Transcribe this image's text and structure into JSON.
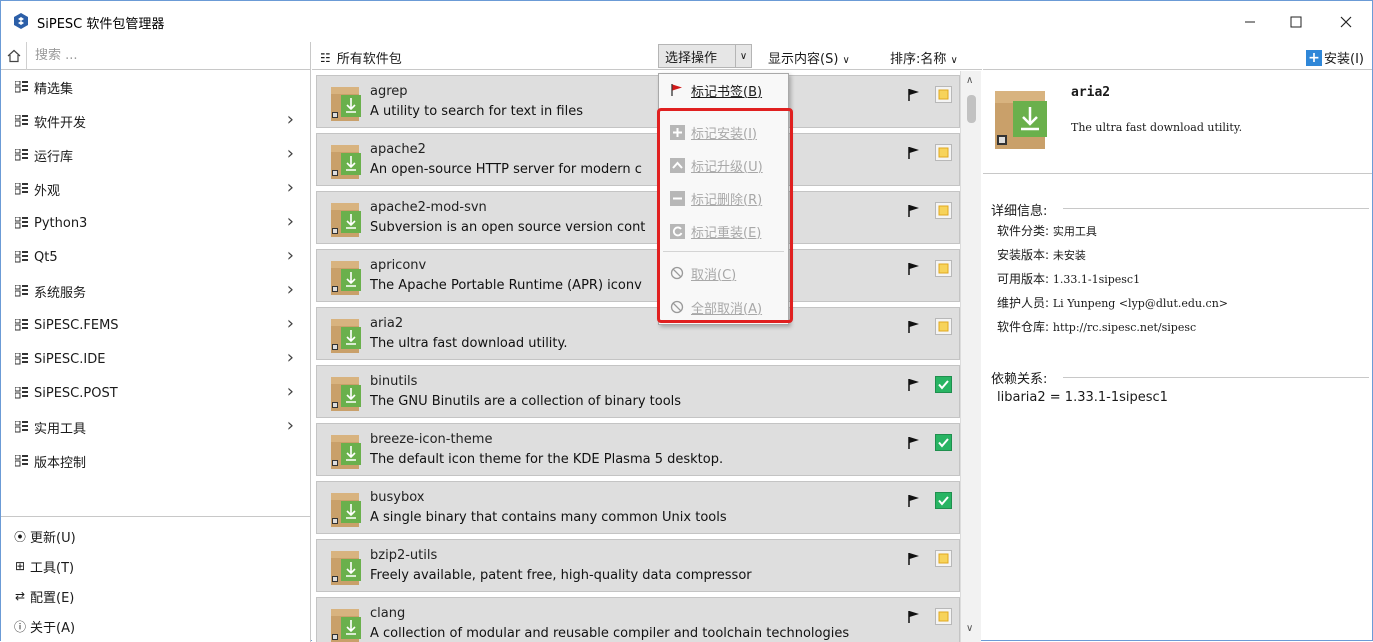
{
  "window": {
    "title": "SiPESC 软件包管理器",
    "controls": [
      "minimize",
      "maximize",
      "close"
    ]
  },
  "sidebar": {
    "search_placeholder": "搜索 ...",
    "categories": [
      {
        "label": "精选集",
        "has_arrow": false
      },
      {
        "label": "软件开发",
        "has_arrow": true
      },
      {
        "label": "运行库",
        "has_arrow": true
      },
      {
        "label": "外观",
        "has_arrow": true
      },
      {
        "label": "Python3",
        "has_arrow": true
      },
      {
        "label": "Qt5",
        "has_arrow": true
      },
      {
        "label": "系统服务",
        "has_arrow": true
      },
      {
        "label": "SiPESC.FEMS",
        "has_arrow": true
      },
      {
        "label": "SiPESC.IDE",
        "has_arrow": true
      },
      {
        "label": "SiPESC.POST",
        "has_arrow": true
      },
      {
        "label": "实用工具",
        "has_arrow": true
      },
      {
        "label": "版本控制",
        "has_arrow": false
      }
    ],
    "bottom": [
      {
        "label": "更新(U)",
        "icon": "update-icon"
      },
      {
        "label": "工具(T)",
        "icon": "toolbox-icon"
      },
      {
        "label": "配置(E)",
        "icon": "settings-icon"
      },
      {
        "label": "关于(A)",
        "icon": "info-icon"
      }
    ]
  },
  "toolbar": {
    "all_packages": "所有软件包",
    "select_action": "选择操作",
    "display_content": "显示内容(S)",
    "sort": "排序:名称",
    "install": "安装(I)"
  },
  "packages": [
    {
      "name": "agrep",
      "desc": "A utility to search for text in files",
      "installed": false
    },
    {
      "name": "apache2",
      "desc": "An open-source HTTP server for modern c",
      "installed": false
    },
    {
      "name": "apache2-mod-svn",
      "desc": "Subversion is an open source version cont",
      "installed": false
    },
    {
      "name": "apriconv",
      "desc": "The Apache Portable Runtime (APR) iconv",
      "installed": false
    },
    {
      "name": "aria2",
      "desc": "The ultra fast download utility.",
      "installed": false
    },
    {
      "name": "binutils",
      "desc": "The GNU Binutils are a collection of binary tools",
      "installed": true
    },
    {
      "name": "breeze-icon-theme",
      "desc": "The default icon theme for the KDE Plasma 5 desktop.",
      "installed": true
    },
    {
      "name": "busybox",
      "desc": "A single binary that contains many common Unix tools",
      "installed": true
    },
    {
      "name": "bzip2-utils",
      "desc": "Freely available, patent free, high-quality data compressor",
      "installed": false
    },
    {
      "name": "clang",
      "desc": "A collection of modular and reusable compiler and toolchain technologies",
      "installed": false
    }
  ],
  "menu": {
    "items": [
      {
        "label": "标记书签(B)",
        "enabled": true,
        "icon": "flag-icon"
      },
      {
        "label": "标记安装(I)",
        "enabled": false,
        "icon": "plus-icon"
      },
      {
        "label": "标记升级(U)",
        "enabled": false,
        "icon": "upgrade-icon"
      },
      {
        "label": "标记删除(R)",
        "enabled": false,
        "icon": "minus-icon"
      },
      {
        "label": "标记重装(E)",
        "enabled": false,
        "icon": "reinstall-icon"
      },
      {
        "label": "取消(C)",
        "enabled": false,
        "icon": "cancel-icon"
      },
      {
        "label": "全部取消(A)",
        "enabled": false,
        "icon": "cancel-all-icon"
      }
    ]
  },
  "detail": {
    "name": "aria2",
    "description": "The ultra fast download utility.",
    "info_section": "详细信息:",
    "rows": [
      {
        "key": "软件分类:",
        "value": "实用工具"
      },
      {
        "key": "安装版本:",
        "value": "未安装"
      },
      {
        "key": "可用版本:",
        "value": "1.33.1-1sipesc1"
      },
      {
        "key": "维护人员:",
        "value": "Li Yunpeng <lyp@dlut.edu.cn>"
      },
      {
        "key": "软件仓库:",
        "value": "http://rc.sipesc.net/sipesc"
      }
    ],
    "deps_section": "依赖关系:",
    "deps": "libaria2 = 1.33.1-1sipesc1"
  },
  "colors": {
    "accent": "#2f87d8",
    "installed_check": "#28b463",
    "highlight_box": "#e02020"
  }
}
